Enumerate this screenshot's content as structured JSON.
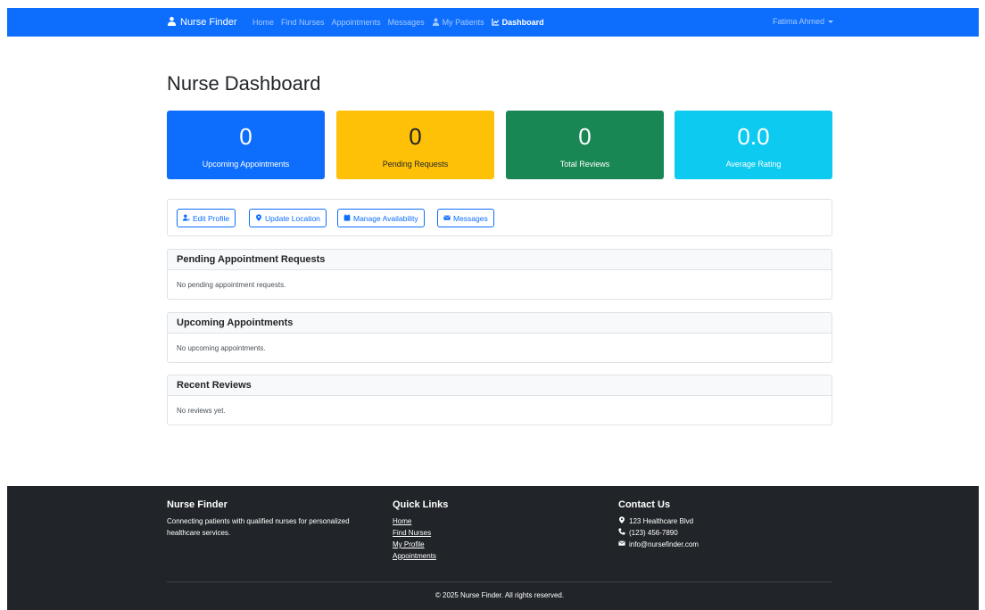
{
  "navbar": {
    "brand": "Nurse Finder",
    "links": [
      {
        "label": "Home"
      },
      {
        "label": "Find Nurses"
      },
      {
        "label": "Appointments"
      },
      {
        "label": "Messages"
      },
      {
        "label": "My Patients"
      },
      {
        "label": "Dashboard"
      }
    ],
    "user": "Fatima Ahmed"
  },
  "main": {
    "title": "Nurse Dashboard",
    "stats": [
      {
        "value": "0",
        "label": "Upcoming Appointments",
        "color": "#0d6efd"
      },
      {
        "value": "0",
        "label": "Pending Requests",
        "color": "#ffc107"
      },
      {
        "value": "0",
        "label": "Total Reviews",
        "color": "#198754"
      },
      {
        "value": "0.0",
        "label": "Average Rating",
        "color": "#0dcaf0"
      }
    ],
    "actions": [
      {
        "label": "Edit Profile",
        "icon": "user-edit-icon"
      },
      {
        "label": "Update Location",
        "icon": "map-marker-icon"
      },
      {
        "label": "Manage Availability",
        "icon": "calendar-icon"
      },
      {
        "label": "Messages",
        "icon": "envelope-icon"
      }
    ],
    "sections": [
      {
        "title": "Pending Appointment Requests",
        "empty": "No pending appointment requests."
      },
      {
        "title": "Upcoming Appointments",
        "empty": "No upcoming appointments."
      },
      {
        "title": "Recent Reviews",
        "empty": "No reviews yet."
      }
    ]
  },
  "footer": {
    "about_title": "Nurse Finder",
    "about_text": "Connecting patients with qualified nurses for personalized healthcare services.",
    "links_title": "Quick Links",
    "links": [
      "Home",
      "Find Nurses",
      "My Profile",
      "Appointments"
    ],
    "contact_title": "Contact Us",
    "address": "123 Healthcare Blvd",
    "phone": "(123) 456-7890",
    "email": "info@nursefinder.com",
    "copyright": "© 2025 Nurse Finder. All rights reserved."
  }
}
